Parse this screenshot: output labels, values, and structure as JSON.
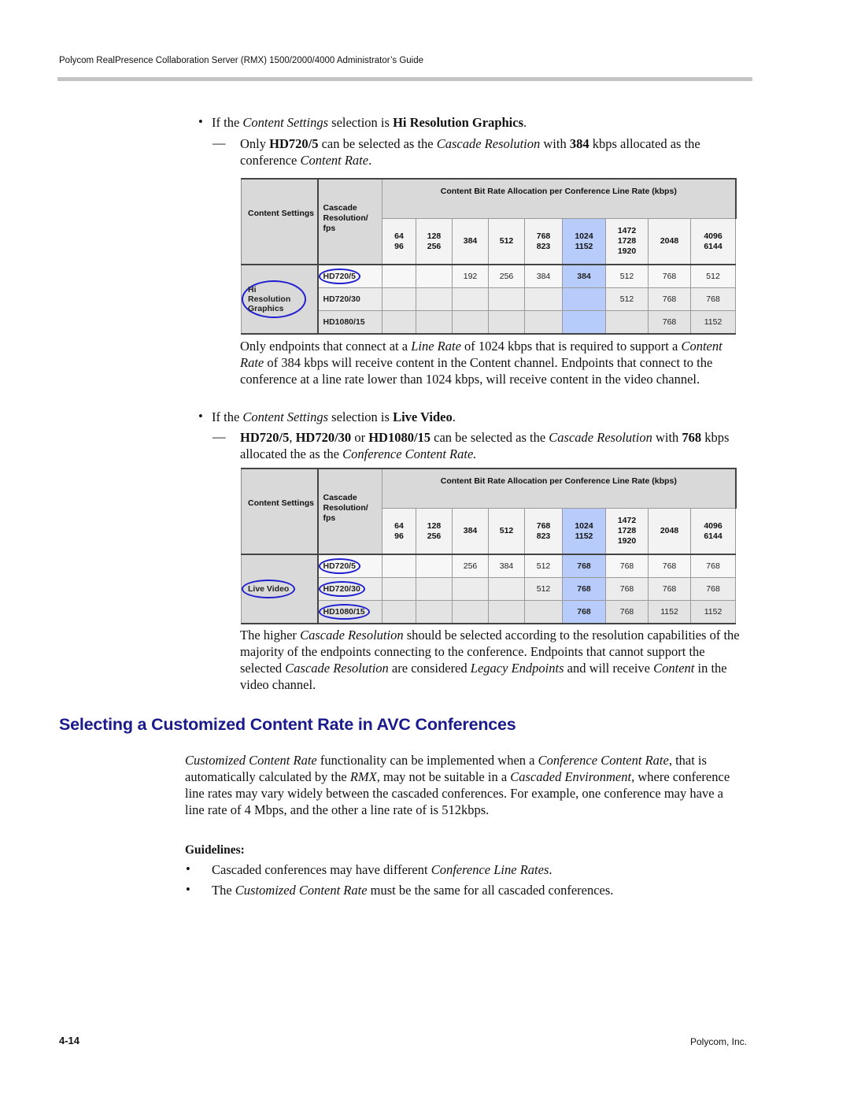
{
  "header": {
    "running_title": "Polycom RealPresence Collaboration Server (RMX) 1500/2000/4000 Administrator’s Guide"
  },
  "section1": {
    "bullet1": {
      "pre": "If the ",
      "em": "Content Settings",
      "mid": " selection is ",
      "strong": "Hi Resolution Graphics",
      "post": "."
    },
    "dash1": {
      "pre": "Only ",
      "strong1": "HD720/5",
      "mid1": " can be selected as the ",
      "em1": "Cascade Resolution",
      "mid2": " with ",
      "strong2": "384",
      "mid3": " kbps allocated as the conference ",
      "em2": "Content Rate",
      "post": "."
    },
    "para1": {
      "t1": "Only endpoints that connect at a ",
      "e1": "Line Rate",
      "t2": " of 1024 kbps that is required to support a ",
      "e2": "Content Rate",
      "t3": " of 384 kbps will receive content in the Content channel. Endpoints that connect to the conference at a line rate lower than 1024 kbps, will receive content in the video channel."
    },
    "bullet2": {
      "pre": "If the ",
      "em": "Content Settings",
      "mid": " selection is ",
      "strong": "Live Video",
      "post": "."
    },
    "dash2": {
      "s1": "HD720/5",
      "t1": ", ",
      "s2": "HD720/30",
      "t2": " or ",
      "s3": "HD1080/15",
      "t3": " can be selected as the ",
      "e1": "Cascade Resolution",
      "t4": " with ",
      "s4": "768",
      "t5": " kbps allocated the as the ",
      "e2": "Conference Content Rate."
    },
    "para2": {
      "t1": "The higher ",
      "e1": "Cascade Resolution",
      "t2": " should be selected according to the resolution capabilities of the majority of the endpoints connecting to the conference. Endpoints that cannot support the selected ",
      "e2": "Cascade Resolution",
      "t3": " are considered ",
      "e3": "Legacy Endpoints",
      "t4": " and will receive ",
      "e4": "Content",
      "t5": " in the video channel."
    }
  },
  "tables": {
    "header_settings": "Content Settings",
    "header_cascade": "Cascade Resolution/ fps",
    "header_group": "Content Bit Rate Allocation per Conference Line Rate (kbps)",
    "line_rates": [
      "64\n96",
      "128\n256",
      "384",
      "512",
      "768\n823",
      "1024\n1152",
      "1472\n1728\n1920",
      "2048",
      "4096\n6144"
    ],
    "highlight_color": "#b8ccfb",
    "annotation_color": "#1f1fcf",
    "hi_res": {
      "settings": "Hi Resolution Graphics",
      "rows": [
        {
          "resolution": "HD720/5",
          "values": [
            "",
            "",
            "192",
            "256",
            "384",
            "384",
            "512",
            "768",
            "512"
          ]
        },
        {
          "resolution": "HD720/30",
          "values": [
            "",
            "",
            "",
            "",
            "",
            "",
            "512",
            "768",
            "768"
          ]
        },
        {
          "resolution": "HD1080/15",
          "values": [
            "",
            "",
            "",
            "",
            "",
            "",
            "",
            "768",
            "1152"
          ]
        }
      ]
    },
    "live_video": {
      "settings": "Live Video",
      "rows": [
        {
          "resolution": "HD720/5",
          "values": [
            "",
            "",
            "256",
            "384",
            "512",
            "768",
            "768",
            "768",
            "768"
          ]
        },
        {
          "resolution": "HD720/30",
          "values": [
            "",
            "",
            "",
            "",
            "512",
            "768",
            "768",
            "768",
            "768"
          ]
        },
        {
          "resolution": "HD1080/15",
          "values": [
            "",
            "",
            "",
            "",
            "",
            "768",
            "768",
            "1152",
            "1152"
          ]
        }
      ]
    }
  },
  "section2": {
    "title": "Selecting a Customized Content Rate in AVC Conferences",
    "intro": {
      "e1": "Customized Content Rate",
      "t1": " functionality can be implemented when a ",
      "e2": "Conference Content Rate",
      "t2": ", that is automatically calculated by the ",
      "e3": "RMX",
      "t3": ", may not be suitable in a ",
      "e4": "Cascaded Environment",
      "t4": ", where conference line rates may vary widely between the cascaded conferences. For example, one conference may have a line rate of 4 Mbps, and the other a line rate of is 512kbps."
    },
    "guidelines_label": "Guidelines:",
    "g1": {
      "t1": "Cascaded conferences may have different ",
      "e1": "Conference Line Rates",
      "t2": "."
    },
    "g2": {
      "t1": "The ",
      "e1": "Customized Content Rate",
      "t2": " must be the same for all cascaded conferences."
    }
  },
  "footer": {
    "page_number": "4-14",
    "company": "Polycom, Inc."
  }
}
